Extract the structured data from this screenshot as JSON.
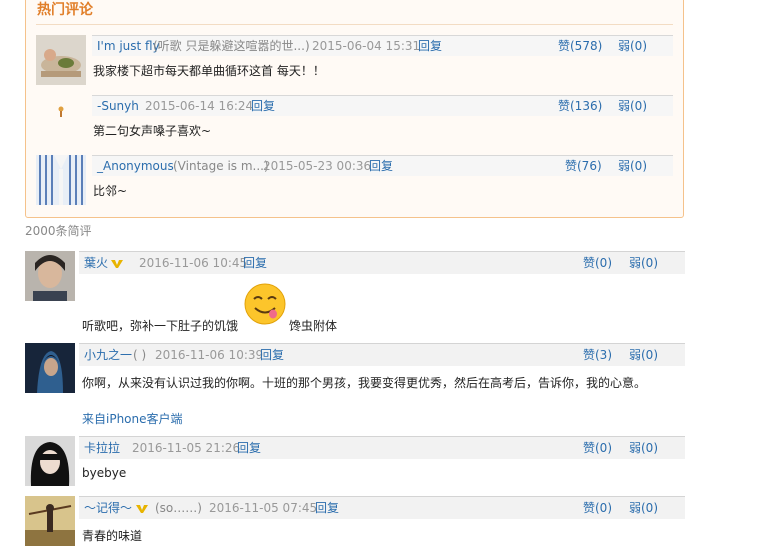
{
  "hot": {
    "title": "热门评论",
    "items": [
      {
        "user": "I'm just fly",
        "sig": "(听歌 只是躲避这喧嚣的世...)",
        "time": "2015-06-04 15:31",
        "reply": "回复",
        "like": "赞(578)",
        "dislike": "弱(0)",
        "text": "我家楼下超市每天都单曲循环这首 每天！！"
      },
      {
        "user": "-Sunyh",
        "sig": "",
        "time": "2015-06-14 16:24",
        "reply": "回复",
        "like": "赞(136)",
        "dislike": "弱(0)",
        "text": "第二句女声嗓子喜欢~"
      },
      {
        "user": "_Anonymous",
        "sig": "(Vintage is m...)",
        "time": "2015-05-23 00:36",
        "reply": "回复",
        "like": "赞(76)",
        "dislike": "弱(0)",
        "text": "比邻~"
      }
    ]
  },
  "count_label": "2000条简评",
  "comments": [
    {
      "user": "葉火",
      "sig": "",
      "time": "2016-11-06 10:45",
      "reply": "回复",
      "like": "赞(0)",
      "dislike": "弱(0)",
      "text_before": "听歌吧，弥补一下肚子的饥饿",
      "text_after": "馋虫附体"
    },
    {
      "user": "小九之一",
      "sig": "( )",
      "time": "2016-11-06 10:39",
      "reply": "回复",
      "like": "赞(3)",
      "dislike": "弱(0)",
      "text": "你啊，从来没有认识过我的你啊。十班的那个男孩，我要变得更优秀，然后在高考后，告诉你，我的心意。",
      "source": "来自iPhone客户端"
    },
    {
      "user": "卡拉拉",
      "sig": "",
      "time": "2016-11-05 21:26",
      "reply": "回复",
      "like": "赞(0)",
      "dislike": "弱(0)",
      "text": "byebye"
    },
    {
      "user": "～记得～",
      "sig": "(so……)",
      "time": "2016-11-05 07:45",
      "reply": "回复",
      "like": "赞(0)",
      "dislike": "弱(0)",
      "text": "青春的味道"
    }
  ]
}
